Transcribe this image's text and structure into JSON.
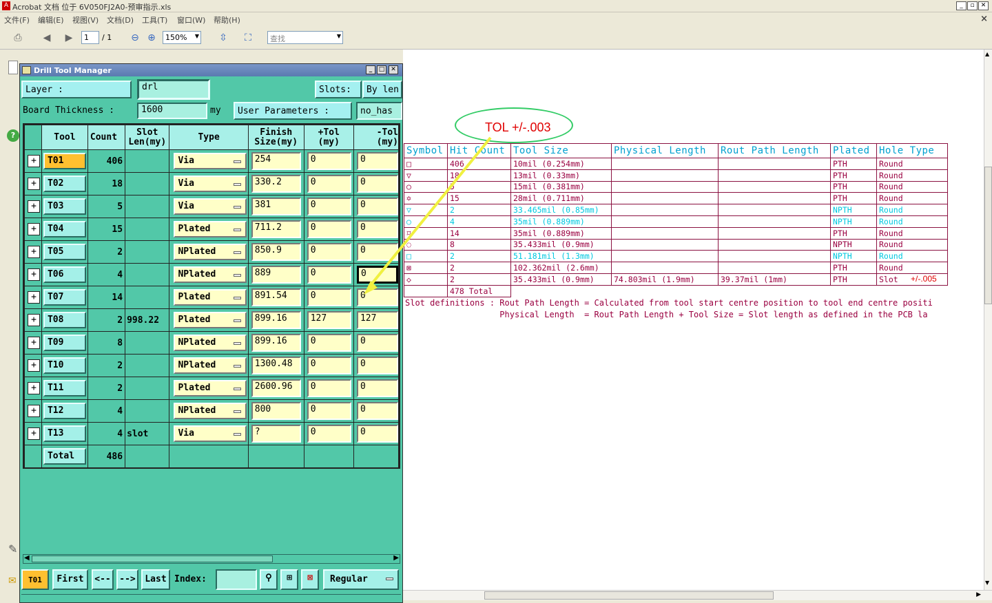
{
  "window": {
    "title": "Acrobat 文档 位于 6V050FJ2A0-预审指示.xls"
  },
  "menu": [
    "文件(F)",
    "编辑(E)",
    "视图(V)",
    "文档(D)",
    "工具(T)",
    "窗口(W)",
    "帮助(H)"
  ],
  "toolbar": {
    "page": "1",
    "page_total": "/ 1",
    "zoom": "150%",
    "search_placeholder": "查找"
  },
  "dtm": {
    "title": "Drill Tool Manager",
    "layer_label": "Layer          :",
    "layer_value": "drl",
    "slots_label": "Slots:",
    "slots_value": "By len",
    "board_label": "Board Thickness :",
    "board_value": "1600",
    "board_unit": "my",
    "user_params_label": "User Parameters :",
    "user_params_value": "no_has",
    "headers": {
      "tool": "Tool",
      "count": "Count",
      "slot1": "Slot",
      "slot2": "Len(my)",
      "type": "Type",
      "finish1": "Finish",
      "finish2": "Size(my)",
      "ptol1": "+Tol",
      "ptol2": "(my)",
      "mtol1": "-Tol",
      "mtol2": "(my)"
    },
    "rows": [
      {
        "tool": "T01",
        "count": "406",
        "slot": "",
        "type": "Via",
        "finish": "254",
        "ptol": "0",
        "mtol": "0"
      },
      {
        "tool": "T02",
        "count": "18",
        "slot": "",
        "type": "Via",
        "finish": "330.2",
        "ptol": "0",
        "mtol": "0"
      },
      {
        "tool": "T03",
        "count": "5",
        "slot": "",
        "type": "Via",
        "finish": "381",
        "ptol": "0",
        "mtol": "0"
      },
      {
        "tool": "T04",
        "count": "15",
        "slot": "",
        "type": "Plated",
        "finish": "711.2",
        "ptol": "0",
        "mtol": "0"
      },
      {
        "tool": "T05",
        "count": "2",
        "slot": "",
        "type": "NPlated",
        "finish": "850.9",
        "ptol": "0",
        "mtol": "0"
      },
      {
        "tool": "T06",
        "count": "4",
        "slot": "",
        "type": "NPlated",
        "finish": "889",
        "ptol": "0",
        "mtol": "0"
      },
      {
        "tool": "T07",
        "count": "14",
        "slot": "",
        "type": "Plated",
        "finish": "891.54",
        "ptol": "0",
        "mtol": "0"
      },
      {
        "tool": "T08",
        "count": "2",
        "slot": "998.22",
        "type": "Plated",
        "finish": "899.16",
        "ptol": "127",
        "mtol": "127"
      },
      {
        "tool": "T09",
        "count": "8",
        "slot": "",
        "type": "NPlated",
        "finish": "899.16",
        "ptol": "0",
        "mtol": "0"
      },
      {
        "tool": "T10",
        "count": "2",
        "slot": "",
        "type": "NPlated",
        "finish": "1300.48",
        "ptol": "0",
        "mtol": "0"
      },
      {
        "tool": "T11",
        "count": "2",
        "slot": "",
        "type": "Plated",
        "finish": "2600.96",
        "ptol": "0",
        "mtol": "0"
      },
      {
        "tool": "T12",
        "count": "4",
        "slot": "",
        "type": "NPlated",
        "finish": "800",
        "ptol": "0",
        "mtol": "0"
      },
      {
        "tool": "T13",
        "count": "4",
        "slot": "slot",
        "type": "Via",
        "finish": "?",
        "ptol": "0",
        "mtol": "0"
      }
    ],
    "total_label": "Total",
    "total_count": "486",
    "bottom": {
      "current": "T01",
      "first": "First",
      "prev": "<--",
      "next": "-->",
      "last": "Last",
      "index_label": "Index:",
      "mode": "Regular"
    }
  },
  "pdf": {
    "headers": [
      "Symbol",
      "Hit Count",
      "Tool Size",
      "Physical Length",
      "Rout Path Length",
      "Plated",
      "Hole Type"
    ],
    "rows": [
      {
        "sym": "□",
        "hit": "406",
        "size": "10mil (0.254mm)",
        "phys": "",
        "rout": "",
        "plated": "PTH",
        "hole": "Round",
        "cyan": false
      },
      {
        "sym": "▽",
        "hit": "18",
        "size": "13mil (0.33mm)",
        "phys": "",
        "rout": "",
        "plated": "PTH",
        "hole": "Round",
        "cyan": false
      },
      {
        "sym": "○",
        "hit": "5",
        "size": "15mil (0.381mm)",
        "phys": "",
        "rout": "",
        "plated": "PTH",
        "hole": "Round",
        "cyan": false
      },
      {
        "sym": "✡",
        "hit": "15",
        "size": "28mil (0.711mm)",
        "phys": "",
        "rout": "",
        "plated": "PTH",
        "hole": "Round",
        "cyan": false
      },
      {
        "sym": "▽",
        "hit": "2",
        "size": "33.465mil (0.85mm)",
        "phys": "",
        "rout": "",
        "plated": "NPTH",
        "hole": "Round",
        "cyan": true
      },
      {
        "sym": "○",
        "hit": "4",
        "size": "35mil (0.889mm)",
        "phys": "",
        "rout": "",
        "plated": "NPTH",
        "hole": "Round",
        "cyan": true
      },
      {
        "sym": "⌑",
        "hit": "14",
        "size": "35mil (0.889mm)",
        "phys": "",
        "rout": "",
        "plated": "PTH",
        "hole": "Round",
        "cyan": false
      },
      {
        "sym": "◌",
        "hit": "8",
        "size": "35.433mil (0.9mm)",
        "phys": "",
        "rout": "",
        "plated": "NPTH",
        "hole": "Round",
        "cyan": false
      },
      {
        "sym": "□",
        "hit": "2",
        "size": "51.181mil (1.3mm)",
        "phys": "",
        "rout": "",
        "plated": "NPTH",
        "hole": "Round",
        "cyan": true
      },
      {
        "sym": "⊠",
        "hit": "2",
        "size": "102.362mil (2.6mm)",
        "phys": "",
        "rout": "",
        "plated": "PTH",
        "hole": "Round",
        "cyan": false
      },
      {
        "sym": "◇",
        "hit": "2",
        "size": "35.433mil (0.9mm)",
        "phys": "74.803mil (1.9mm)",
        "rout": "39.37mil (1mm)",
        "plated": "PTH",
        "hole": "Slot",
        "cyan": false
      }
    ],
    "total": "478 Total",
    "slotdef1": "Slot definitions : Rout Path Length = Calculated from tool start centre position to tool end centre positi",
    "slotdef2": "                   Physical Length  = Rout Path Length + Tool Size = Slot length as defined in the PCB la"
  },
  "annotation": {
    "tol": "TOL +/-.003",
    "tol_small": "+/-.005",
    "color": "#e00000",
    "ellipse_color": "#33cc66",
    "arrow_color": "#f0f040"
  }
}
